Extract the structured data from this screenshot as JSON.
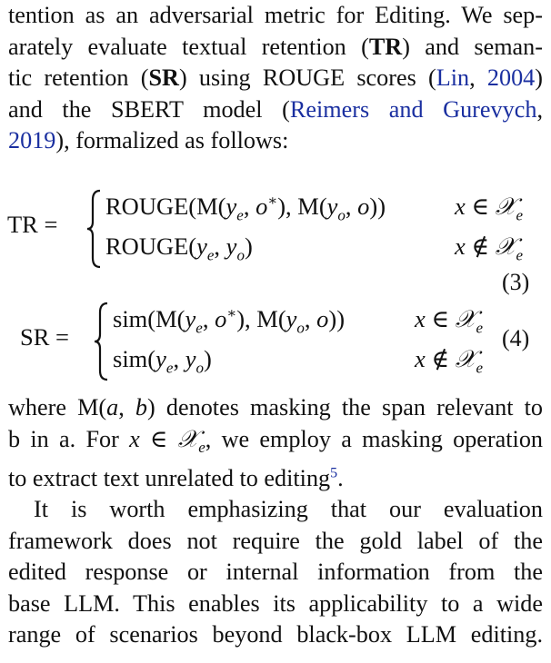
{
  "paragraph1": {
    "lines": [
      "tention as an adversarial metric for Editing. We sep-",
      [
        "arately evaluate textual retention (",
        "TR",
        ") and seman-"
      ],
      [
        "tic retention (",
        "SR",
        ") using ROUGE scores (",
        "Lin",
        ", ",
        "2004",
        ")"
      ],
      [
        "and the SBERT model (",
        "Reimers and Gurevych",
        ","
      ],
      [
        "2019",
        "), formalized as follows:"
      ]
    ]
  },
  "equation3": {
    "lhs": "TR =",
    "case1": "ROUGE(M(y_e, o*), M(y_o, o))",
    "cond1": "x ∈ 𝒳_e",
    "case2": "ROUGE(y_e, y_o)",
    "cond2": "x ∉ 𝒳_e",
    "number": "(3)"
  },
  "equation4": {
    "lhs": "SR =",
    "case1": "sim(M(y_e, o*), M(y_o, o))",
    "cond1": "x ∈ 𝒳_e",
    "case2": "sim(y_e, y_o)",
    "cond2": "x ∉ 𝒳_e",
    "number": "(4)"
  },
  "paragraph2": {
    "line1": [
      "where ",
      "M(a, b)",
      " denotes masking the span relevant to"
    ],
    "line2": [
      "b in a. For ",
      "x ∈ 𝒳_e",
      ", we employ a masking operation"
    ],
    "line3": [
      "to extract text unrelated to editing",
      "5",
      "."
    ]
  },
  "paragraph3": {
    "lines": [
      "It is worth emphasizing that our evaluation",
      "framework does not require the gold label of the",
      "edited response or internal information from the",
      "base LLM. This enables its applicability to a wide",
      "range of scenarios beyond black-box LLM editing."
    ]
  },
  "colors": {
    "text": "#111111",
    "citation": "#1a2fa0"
  }
}
